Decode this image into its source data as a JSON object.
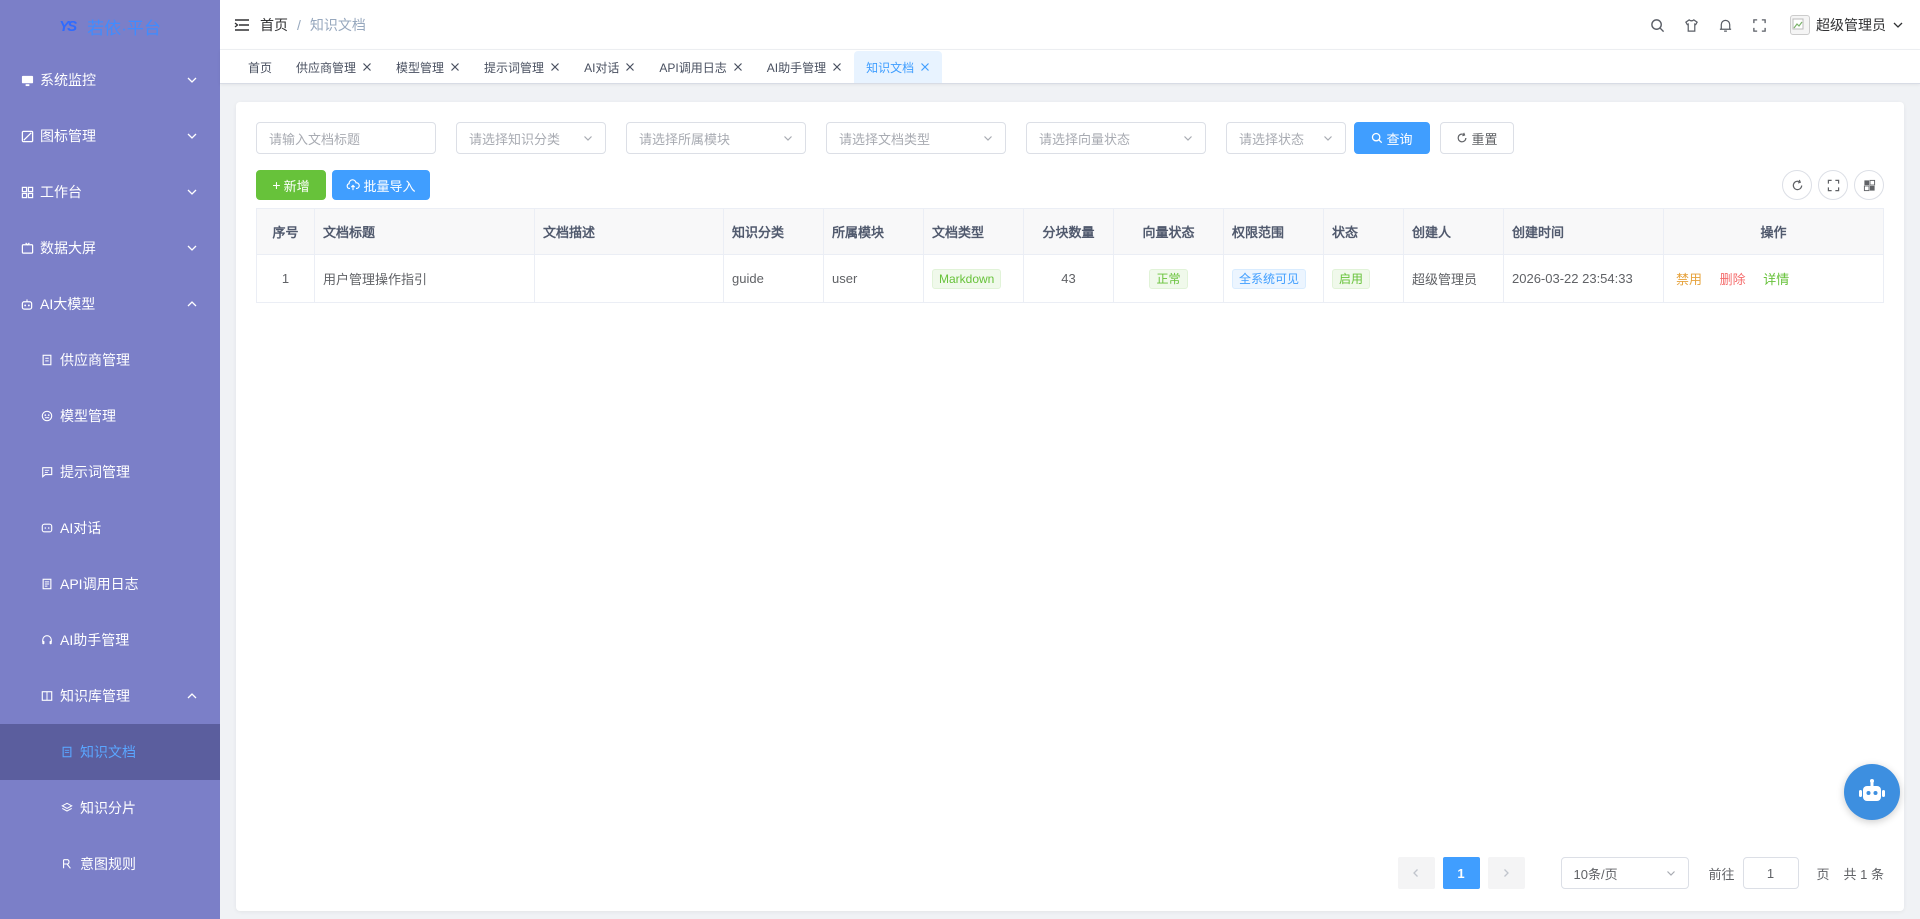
{
  "sidebar": {
    "logo_text": "若依·平台",
    "items": [
      {
        "label": "系统监控",
        "icon": "monitor-icon",
        "arrow": "down"
      },
      {
        "label": "图标管理",
        "icon": "image-icon",
        "arrow": "down"
      },
      {
        "label": "工作台",
        "icon": "dashboard-icon",
        "arrow": "down"
      },
      {
        "label": "数据大屏",
        "icon": "screen-icon",
        "arrow": "down"
      },
      {
        "label": "AI大模型",
        "icon": "robot-icon",
        "arrow": "up"
      }
    ],
    "ai_children": [
      {
        "label": "供应商管理",
        "icon": "building-icon"
      },
      {
        "label": "模型管理",
        "icon": "model-icon"
      },
      {
        "label": "提示词管理",
        "icon": "message-icon"
      },
      {
        "label": "AI对话",
        "icon": "chat-icon"
      },
      {
        "label": "API调用日志",
        "icon": "log-icon"
      },
      {
        "label": "AI助手管理",
        "icon": "headset-icon"
      },
      {
        "label": "知识库管理",
        "icon": "book-icon"
      }
    ],
    "kb_children": [
      {
        "label": "知识文档",
        "icon": "document-icon"
      },
      {
        "label": "知识分片",
        "icon": "layers-icon"
      },
      {
        "label": "意图规则",
        "icon": "rule-icon"
      }
    ]
  },
  "header": {
    "breadcrumb_home": "首页",
    "breadcrumb_sep": "/",
    "breadcrumb_current": "知识文档",
    "username": "超级管理员"
  },
  "tags": [
    {
      "label": "首页",
      "closable": false
    },
    {
      "label": "供应商管理",
      "closable": true
    },
    {
      "label": "模型管理",
      "closable": true
    },
    {
      "label": "提示词管理",
      "closable": true
    },
    {
      "label": "AI对话",
      "closable": true
    },
    {
      "label": "API调用日志",
      "closable": true
    },
    {
      "label": "AI助手管理",
      "closable": true
    },
    {
      "label": "知识文档",
      "closable": true
    }
  ],
  "filters": {
    "title_placeholder": "请输入文档标题",
    "category_placeholder": "请选择知识分类",
    "module_placeholder": "请选择所属模块",
    "doc_type_placeholder": "请选择文档类型",
    "vector_status_placeholder": "请选择向量状态",
    "status_placeholder": "请选择状态",
    "search_label": "查询",
    "reset_label": "重置"
  },
  "toolbar": {
    "add_label": "新增",
    "import_label": "批量导入"
  },
  "table": {
    "headers": [
      "序号",
      "文档标题",
      "文档描述",
      "知识分类",
      "所属模块",
      "文档类型",
      "分块数量",
      "向量状态",
      "权限范围",
      "状态",
      "创建人",
      "创建时间",
      "操作"
    ],
    "rows": [
      {
        "index": "1",
        "title": "用户管理操作指引",
        "description": "",
        "category": "guide",
        "module": "user",
        "doc_type": "Markdown",
        "chunk_count": "43",
        "vector_status": "正常",
        "scope": "全系统可见",
        "status": "启用",
        "creator": "超级管理员",
        "created_at": "2026-03-22 23:54:33",
        "actions": {
          "disable": "禁用",
          "delete": "删除",
          "detail": "详情"
        }
      }
    ]
  },
  "pagination": {
    "current_page": "1",
    "page_size": "10条/页",
    "goto_label": "前往",
    "goto_value": "1",
    "page_unit": "页",
    "total": "共 1 条"
  },
  "colors": {
    "primary": "#409eff",
    "success": "#67c23a",
    "sidebar_bg": "#7b7fc8",
    "disable_op": "#e6a23c",
    "delete_op": "#f56c6c",
    "detail_op": "#67c23a"
  }
}
